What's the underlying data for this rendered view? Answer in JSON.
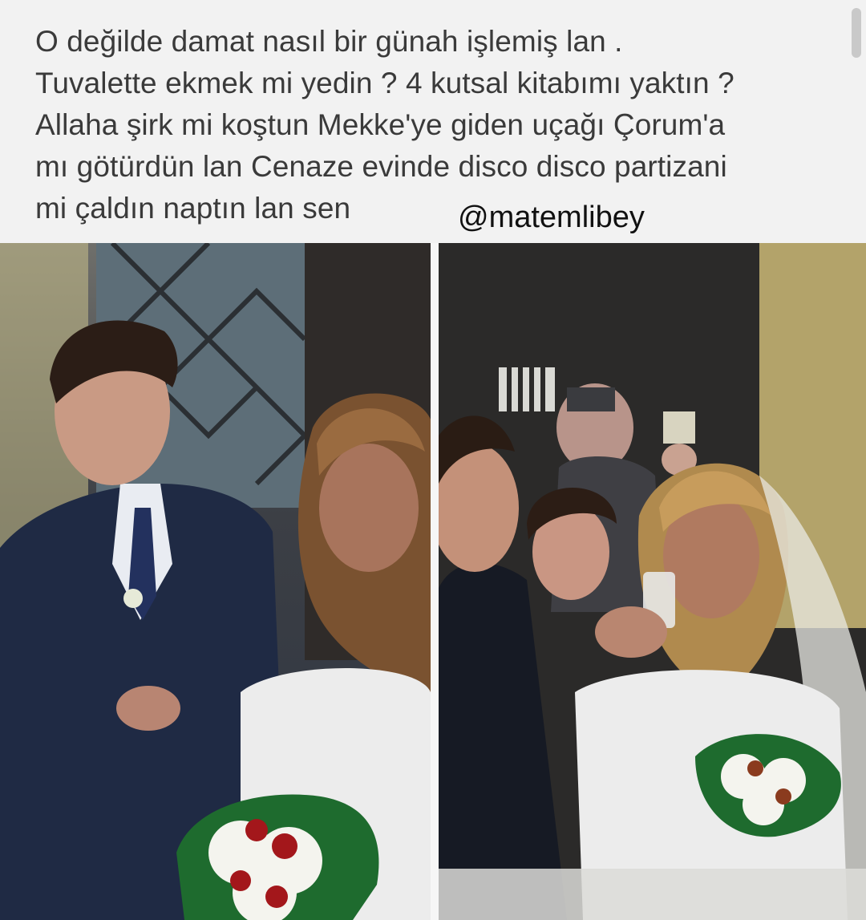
{
  "post": {
    "lines": [
      "O değilde damat nasıl bir günah işlemiş lan .",
      "Tuvalette ekmek mi yedin ? 4 kutsal kitabımı yaktın ?",
      "Allaha şirk mi koştun Mekke'ye giden uçağı Çorum'a",
      "mı götürdün lan Cenaze evinde disco disco partizani",
      "mi çaldın naptın lan sen"
    ]
  },
  "watermark": "@matemlibey",
  "colors": {
    "background": "#f2f2f2",
    "text": "#3a3a3a",
    "suit": "#1f2a44",
    "dress": "#ececec",
    "bouquet_green": "#1e6b2e",
    "rose_red": "#a3171b"
  }
}
